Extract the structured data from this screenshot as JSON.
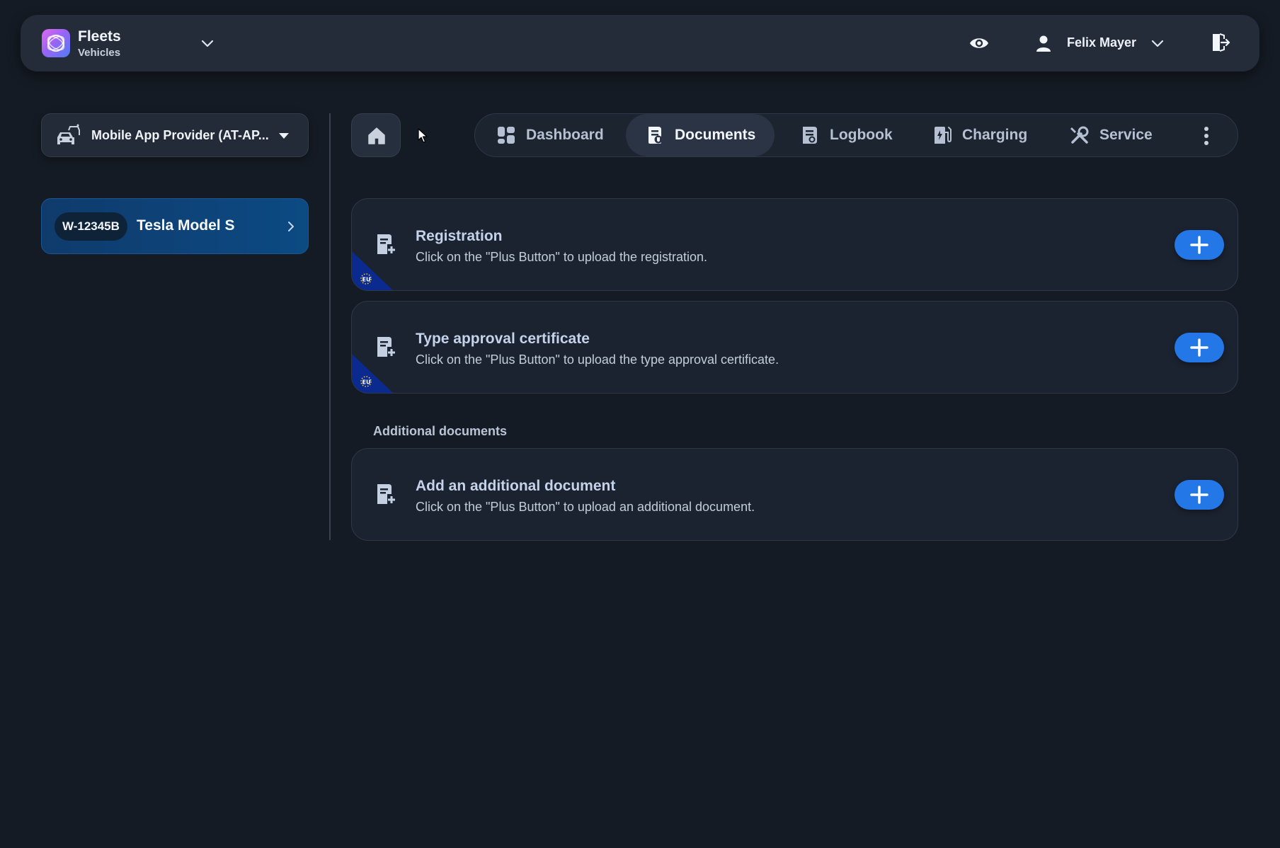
{
  "header": {
    "app_title": "Fleets",
    "app_subtitle": "Vehicles",
    "user_name": "Felix Mayer"
  },
  "sidebar": {
    "provider_select": {
      "selected": "Mobile App Provider (AT-AP..."
    },
    "vehicles": [
      {
        "plate": "W-12345B",
        "model": "Tesla Model S"
      }
    ]
  },
  "tabs": [
    {
      "label": "Dashboard",
      "icon": "dashboard-icon",
      "active": false
    },
    {
      "label": "Documents",
      "icon": "documents-icon",
      "active": true
    },
    {
      "label": "Logbook",
      "icon": "logbook-icon",
      "active": false
    },
    {
      "label": "Charging",
      "icon": "charging-icon",
      "active": false
    },
    {
      "label": "Service",
      "icon": "service-icon",
      "active": false
    }
  ],
  "documents": [
    {
      "title": "Registration",
      "description": "Click on the \"Plus Button\" to upload the registration.",
      "badge": "EU"
    },
    {
      "title": "Type approval certificate",
      "description": "Click on the \"Plus Button\" to upload the type approval certificate.",
      "badge": "EU"
    }
  ],
  "additional": {
    "section_label": "Additional documents",
    "title": "Add an additional document",
    "description": "Click on the \"Plus Button\" to upload an additional document."
  },
  "colors": {
    "background": "#151b24",
    "accent_blue": "#2477e6",
    "vehicle_card": "#0c4a83",
    "eu_blue": "#0b2a8f"
  }
}
